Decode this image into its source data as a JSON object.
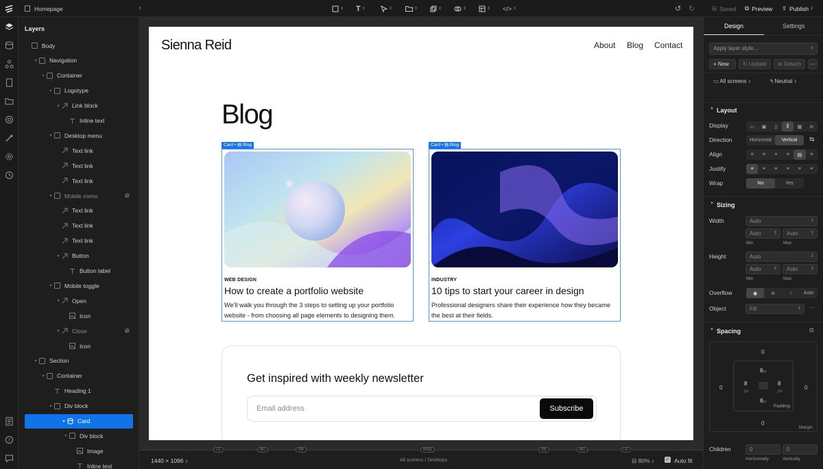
{
  "topbar": {
    "page_name": "Homepage",
    "saved_label": "Saved",
    "preview_label": "Preview",
    "publish_label": "Publish"
  },
  "layers": {
    "title": "Layers",
    "items": [
      {
        "label": "Body"
      },
      {
        "label": "Navigation"
      },
      {
        "label": "Container"
      },
      {
        "label": "Logotype"
      },
      {
        "label": "Link block"
      },
      {
        "label": "Inline text"
      },
      {
        "label": "Desktop menu"
      },
      {
        "label": "Text link"
      },
      {
        "label": "Text link"
      },
      {
        "label": "Text link"
      },
      {
        "label": "Mobile menu"
      },
      {
        "label": "Text link"
      },
      {
        "label": "Text link"
      },
      {
        "label": "Text link"
      },
      {
        "label": "Button"
      },
      {
        "label": "Button label"
      },
      {
        "label": "Mobile toggle"
      },
      {
        "label": "Open"
      },
      {
        "label": "Icon"
      },
      {
        "label": "Close"
      },
      {
        "label": "Icon"
      },
      {
        "label": "Section"
      },
      {
        "label": "Container"
      },
      {
        "label": "Heading 1"
      },
      {
        "label": "Div block"
      },
      {
        "label": "Card"
      },
      {
        "label": "Div block"
      },
      {
        "label": "Image"
      },
      {
        "label": "Inline text"
      }
    ]
  },
  "canvas": {
    "brand": "Sienna Reid",
    "nav": [
      "About",
      "Blog",
      "Contact"
    ],
    "heading": "Blog",
    "cards": [
      {
        "tag": "Card • ▤ Blog",
        "category": "WEB DESIGN",
        "title": "How to create a portfolio website",
        "description": "We'll walk you through the 3 steps to setting up your portfolio website - from choosing all page elements to designing them."
      },
      {
        "tag": "Card • ▤ Blog",
        "category": "INDUSTRY",
        "title": "10 tips to start your career in design",
        "description": "Professional designers share their experience how they became the best at their fields."
      }
    ],
    "newsletter": {
      "title": "Get inspired with weekly newsletter",
      "email_placeholder": "Email address",
      "subscribe_label": "Subscribe"
    }
  },
  "bottombar": {
    "canvas_size": "1440 × 1096",
    "screens_label": "All screens / Desktops",
    "breakpoints": [
      "LG",
      "MD",
      "SM",
      "BASE",
      "SM",
      "MD",
      "LG"
    ],
    "zoom": "80%",
    "autofit_label": "Auto fit"
  },
  "design": {
    "tabs": [
      "Design",
      "Settings"
    ],
    "apply_style": "Apply layer style...",
    "new_label": "New",
    "update_label": "Update",
    "detach_label": "Detach",
    "screens": "All screens",
    "state": "Neutral",
    "layout": {
      "title": "Layout",
      "display_label": "Display",
      "direction_label": "Direction",
      "direction_options": [
        "Horizontal",
        "Vertical"
      ],
      "align_label": "Align",
      "justify_label": "Justify",
      "wrap_label": "Wrap",
      "wrap_options": [
        "No",
        "Yes"
      ]
    },
    "sizing": {
      "title": "Sizing",
      "width_label": "Width",
      "height_label": "Height",
      "auto": "Auto",
      "min": "Min",
      "max": "Max",
      "overflow_label": "Overflow",
      "overflow_auto": "Auto",
      "object_label": "Object",
      "object_value": "Fill"
    },
    "spacing": {
      "title": "Spacing",
      "margin_top": "0",
      "margin_left": "0",
      "margin_right": "0",
      "margin_bottom": "0",
      "padding_top": "8",
      "padding_left": "8",
      "padding_right": "8",
      "padding_bottom": "8",
      "unit": "px",
      "padding_label": "Padding",
      "margin_label": "Margin"
    },
    "children": {
      "label": "Children",
      "horizontal": "0",
      "vertical": "0",
      "horizontal_label": "Horizontally",
      "vertical_label": "Vertically"
    }
  },
  "colors": {
    "accent": "#0f73ea",
    "selection_outline": "#4b9be8",
    "panel_bg": "#1e1e1e",
    "canvas_bg": "#2a2a2a"
  }
}
